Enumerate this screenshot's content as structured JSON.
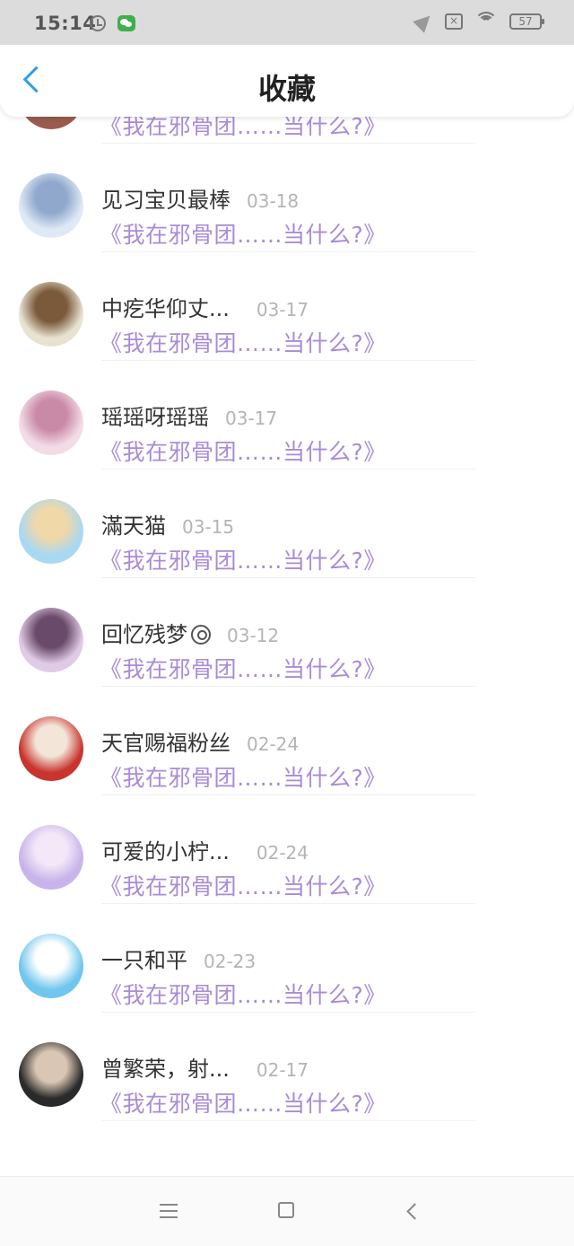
{
  "status_bar": {
    "time": "15:14",
    "battery": "57"
  },
  "header": {
    "title": "收藏"
  },
  "entries": [
    {
      "name": "",
      "date": "",
      "book": "《我在邪骨团……当什么?》",
      "avatar_colors": [
        "#9b5b4e",
        "#3a7a4a"
      ]
    },
    {
      "name": "见习宝贝最棒",
      "date": "03-18",
      "book": "《我在邪骨团……当什么?》",
      "avatar_colors": [
        "#dfe9f6",
        "#8fa8cc"
      ]
    },
    {
      "name": "中疙华仰丈...",
      "date": "03-17",
      "book": "《我在邪骨团……当什么?》",
      "avatar_colors": [
        "#e8e2d2",
        "#7a5a3a"
      ]
    },
    {
      "name": "瑶瑶呀瑶瑶",
      "date": "03-17",
      "book": "《我在邪骨团……当什么?》",
      "avatar_colors": [
        "#f3dce6",
        "#c98aa8"
      ]
    },
    {
      "name": "滿天猫",
      "date": "03-15",
      "book": "《我在邪骨团……当什么?》",
      "avatar_colors": [
        "#a9d8f2",
        "#f0d8a8"
      ]
    },
    {
      "name": "回忆残梦",
      "date": "03-12",
      "book": "《我在邪骨团……当什么?》",
      "avatar_colors": [
        "#e0cbe6",
        "#6a4a6a"
      ]
    },
    {
      "name": "天官赐福粉丝",
      "date": "02-24",
      "book": "《我在邪骨团……当什么?》",
      "avatar_colors": [
        "#c8342e",
        "#f3e6d8"
      ]
    },
    {
      "name": "可爱的小柠...",
      "date": "02-24",
      "book": "《我在邪骨团……当什么?》",
      "avatar_colors": [
        "#c8b4ea",
        "#f4e8f8"
      ]
    },
    {
      "name": "一只和平",
      "date": "02-23",
      "book": "《我在邪骨团……当什么?》",
      "avatar_colors": [
        "#6fc6ee",
        "#ffffff"
      ]
    },
    {
      "name": "曾繁荣，射...",
      "date": "02-17",
      "book": "《我在邪骨团……当什么?》",
      "avatar_colors": [
        "#2a2a2a",
        "#d9c6b4"
      ]
    }
  ]
}
